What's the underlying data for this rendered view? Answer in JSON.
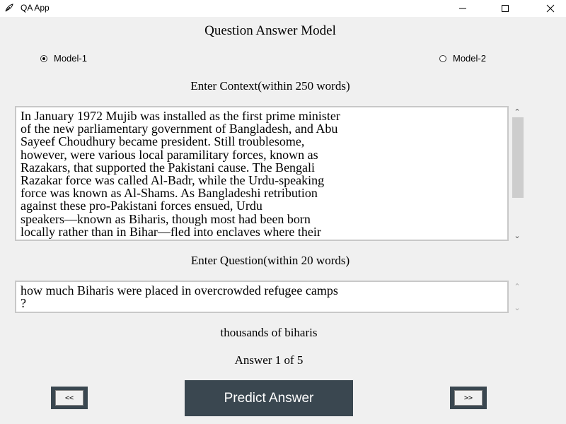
{
  "window": {
    "title": "QA App",
    "icon": "feather-icon",
    "minimize_icon": "minimize-icon",
    "maximize_icon": "maximize-icon",
    "close_icon": "close-icon"
  },
  "header": {
    "title": "Question Answer Model"
  },
  "models": {
    "selected": "Model-1",
    "options": [
      {
        "label": "Model-1",
        "checked": true
      },
      {
        "label": "Model-2",
        "checked": false
      }
    ]
  },
  "context": {
    "label": "Enter Context(within 250 words)",
    "value": "In January 1972 Mujib was installed as the first prime minister\nof the new parliamentary government of Bangladesh, and Abu\nSayeef Choudhury became president. Still troublesome,\nhowever, were various local paramilitary forces, known as\nRazakars, that supported the Pakistani cause. The Bengali\nRazakar force was called Al-Badr, while the Urdu-speaking\nforce was known as Al-Shams. As Bangladeshi retribution\nagainst these pro-Pakistani forces ensued, Urdu\nspeakers—known as Biharis, though most had been born\nlocally rather than in Bihar—fled into enclaves where their"
  },
  "question": {
    "label": "Enter Question(within 20 words)",
    "value": "how much Biharis were placed in overcrowded refugee camps\n?"
  },
  "answer": {
    "text": "thousands of biharis",
    "counter": "Answer 1 of 5"
  },
  "buttons": {
    "prev": "<<",
    "predict": "Predict Answer",
    "next": ">>"
  }
}
